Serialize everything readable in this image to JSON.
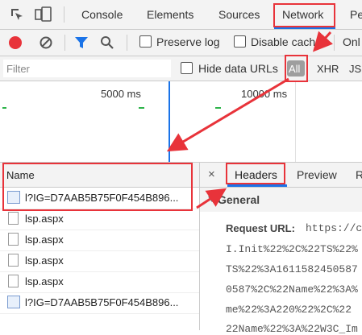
{
  "tabs": {
    "console": "Console",
    "elements": "Elements",
    "sources": "Sources",
    "network": "Network",
    "partial": "Pe"
  },
  "toolbar": {
    "preserve_log": "Preserve log",
    "disable_cache": "Disable cache",
    "online_partial": "Onl"
  },
  "filterbar": {
    "placeholder": "Filter",
    "hide_data_urls": "Hide data URLs",
    "all": "All",
    "xhr": "XHR",
    "js": "JS"
  },
  "overview": {
    "t1": "5000 ms",
    "t2": "10000 ms"
  },
  "requests": {
    "header": "Name",
    "rows": [
      {
        "name": "l?IG=D7AAB5B75F0F454B896...",
        "type": "image"
      },
      {
        "name": "lsp.aspx",
        "type": "doc"
      },
      {
        "name": "lsp.aspx",
        "type": "doc"
      },
      {
        "name": "lsp.aspx",
        "type": "doc"
      },
      {
        "name": "lsp.aspx",
        "type": "doc"
      },
      {
        "name": "l?IG=D7AAB5B75F0F454B896...",
        "type": "image"
      }
    ]
  },
  "detail": {
    "close": "×",
    "headers_tab": "Headers",
    "preview_tab": "Preview",
    "partial_tab": "R",
    "section": "General",
    "request_url_label": "Request URL:",
    "request_url_value": "https://c",
    "lines": [
      "I.Init%22%2C%22TS%22%",
      "TS%22%3A1611582450587",
      "0587%2C%22Name%22%3A%",
      "me%22%3A220%22%2C%22",
      "22Name%22%3A%22W3C_Im"
    ]
  },
  "colors": {
    "annotation": "#e8333a",
    "accent": "#1a73e8",
    "record": "#e8333a"
  }
}
